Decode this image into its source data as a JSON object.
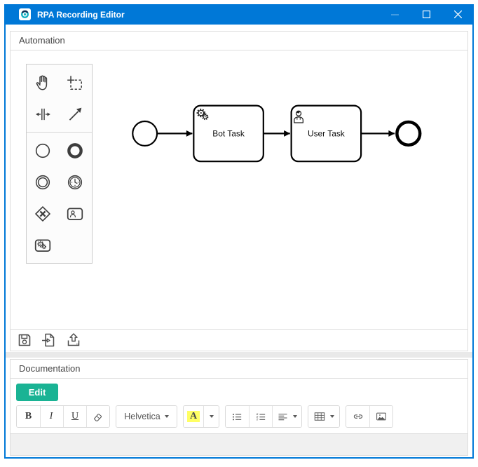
{
  "window": {
    "title": "RPA Recording Editor",
    "titlebar_color": "#0078d7",
    "controls": [
      {
        "name": "minimize"
      },
      {
        "name": "maximize"
      },
      {
        "name": "close"
      }
    ]
  },
  "automation": {
    "header": "Automation",
    "palette": [
      {
        "name": "hand-tool"
      },
      {
        "name": "lasso-tool"
      },
      {
        "name": "space-tool"
      },
      {
        "name": "global-connect-tool"
      },
      {
        "name": "create-start-event"
      },
      {
        "name": "create-end-event"
      },
      {
        "name": "create-intermediate-event"
      },
      {
        "name": "create-timer-event"
      },
      {
        "name": "create-gateway"
      },
      {
        "name": "create-user-task"
      },
      {
        "name": "create-bot-task"
      }
    ],
    "diagram": {
      "nodes": [
        {
          "type": "start-event",
          "label": ""
        },
        {
          "type": "bot-task",
          "label": "Bot Task"
        },
        {
          "type": "user-task",
          "label": "User Task"
        },
        {
          "type": "end-event",
          "label": ""
        }
      ],
      "connections": [
        "start-event to bot-task",
        "bot-task to user-task",
        "user-task to end-event"
      ]
    },
    "footer_actions": [
      {
        "name": "save"
      },
      {
        "name": "open"
      },
      {
        "name": "export"
      }
    ]
  },
  "documentation": {
    "header": "Documentation",
    "edit_button": {
      "label": "Edit",
      "color": "#1ab394"
    },
    "toolbar": {
      "bold": "B",
      "italic": "I",
      "underline": "U",
      "font_name": "Helvetica",
      "color_button": "A",
      "color_highlight": "#ffff64",
      "actions": [
        "clear-formatting",
        "unordered-list",
        "ordered-list",
        "paragraph-align",
        "table",
        "link",
        "picture"
      ]
    },
    "editor_content": ""
  }
}
